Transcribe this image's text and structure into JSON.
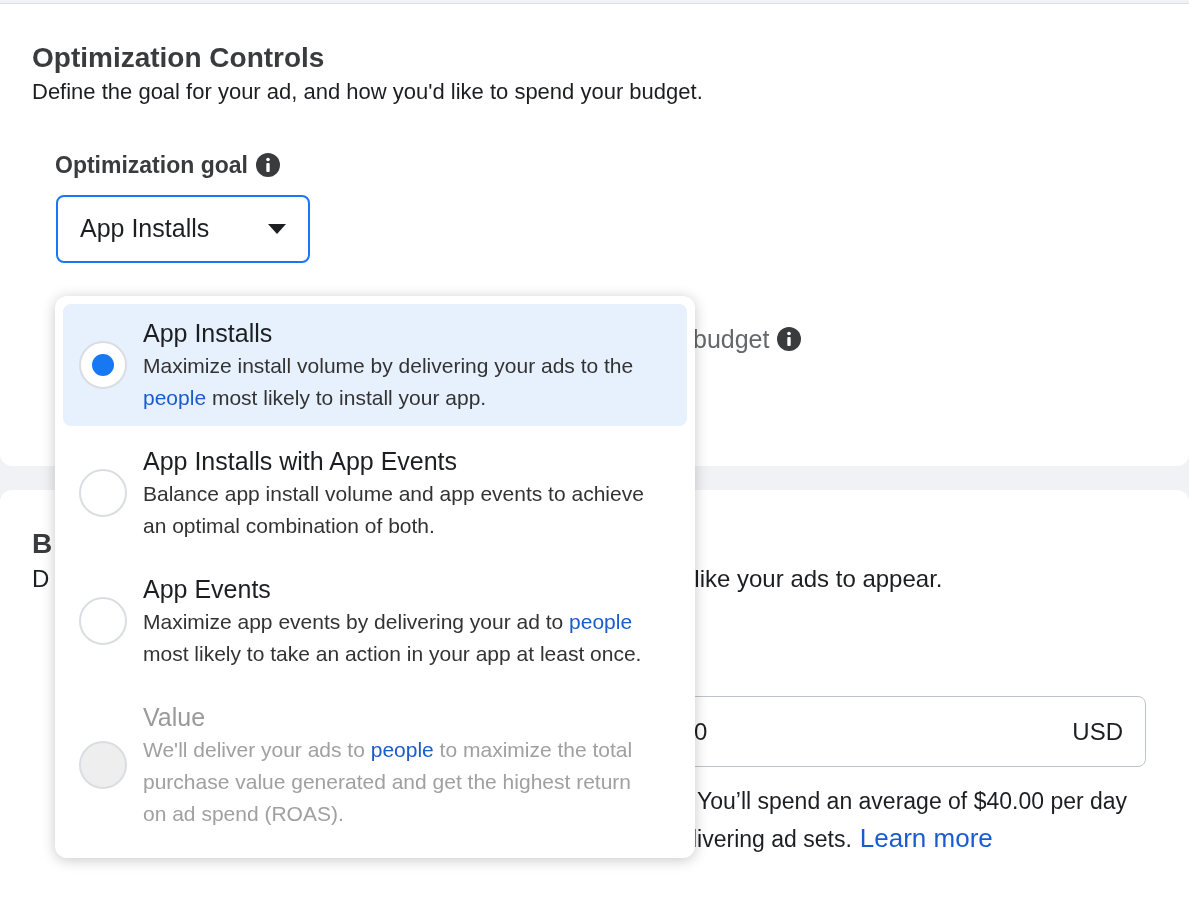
{
  "optimization_card": {
    "title": "Optimization Controls",
    "description": "Define the goal for your ad, and how you'd like to spend your budget.",
    "goal_label": "Optimization goal",
    "goal_select": {
      "value": "App Installs",
      "focused": true
    },
    "budget_label": "budget"
  },
  "budget_card": {
    "title": "B",
    "description_left": "D",
    "description_right": "like your ads to appear.",
    "amount_field": {
      "value": "0",
      "currency": "USD"
    },
    "note_line_1": "You’ll spend an average of $40.00 per day",
    "note_line_2": "livering ad sets.",
    "learn_more": "Learn more"
  },
  "dropdown": {
    "options": [
      {
        "title": "App Installs",
        "before": "Maximize install volume by delivering your ads to the ",
        "link": "people",
        "after": " most likely to install your app.",
        "selected": true,
        "disabled": false
      },
      {
        "title": "App Installs with App Events",
        "before": "Balance app install volume and app events to achieve an optimal combination of both.",
        "selected": false,
        "disabled": false
      },
      {
        "title": "App Events",
        "before": "Maximize app events by delivering your ad to ",
        "link": "people",
        "after": " most likely to take an action in your app at least once.",
        "selected": false,
        "disabled": false
      },
      {
        "title": "Value",
        "before": "We'll deliver your ads to ",
        "link": "people",
        "after": " to maximize the total purchase value generated and get the highest return on ad spend (ROAS).",
        "selected": false,
        "disabled": true
      }
    ]
  }
}
